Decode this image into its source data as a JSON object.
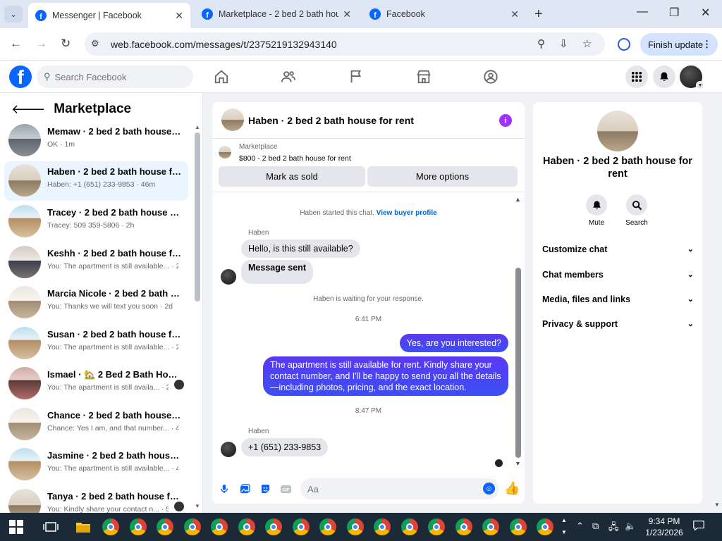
{
  "browser": {
    "tabs": [
      {
        "title": "Messenger | Facebook",
        "active": true
      },
      {
        "title": "Marketplace - 2 bed 2 bath hou",
        "active": false
      },
      {
        "title": "Facebook",
        "active": false
      }
    ],
    "url": "web.facebook.com/messages/t/2375219132943140",
    "update_button": "Finish update"
  },
  "fb_header": {
    "search_placeholder": "Search Facebook"
  },
  "sidebar": {
    "title": "Marketplace",
    "conversations": [
      {
        "name": "Memaw · 2 bed 2 bath house fo...",
        "preview": "OK · 1m",
        "thumb": "room-a"
      },
      {
        "name": "Haben · 2 bed 2 bath house for ...",
        "preview": "Haben: +1 (651) 233-9853 · 46m",
        "thumb": "room-b"
      },
      {
        "name": "Tracey · 2 bed 2 bath house for ...",
        "preview": "Tracey: 509 359-5806 · 2h",
        "thumb": "room-c"
      },
      {
        "name": "Keshh · 2 bed 2 bath house for r...",
        "preview": "You: The apartment is still available... · 2h",
        "thumb": "room-d"
      },
      {
        "name": "Marcia Nicole · 2 bed 2 bath ho...",
        "preview": "You: Thanks we will text you soon · 2d",
        "thumb": "room-e"
      },
      {
        "name": "Susan · 2 bed 2 bath house for r...",
        "preview": "You: The apartment is still available... · 2d",
        "thumb": "room-c"
      },
      {
        "name": "Ismael · 🏡 2 Bed 2 Bath Hou...",
        "preview": "You: The apartment is still availa... · 2d",
        "thumb": "room-f"
      },
      {
        "name": "Chance · 2 bed 2 bath house for...",
        "preview": "Chance: Yes I am, and that number... · 4d",
        "thumb": "room-e"
      },
      {
        "name": "Jasmine · 2 bed 2 bath house fo...",
        "preview": "You: The apartment is still available... · 4d",
        "thumb": "room-c"
      },
      {
        "name": "Tanya · 2 bed 2 bath house fo...",
        "preview": "You: Kindly share your contact n... · 5d",
        "thumb": "room-b"
      }
    ]
  },
  "chat": {
    "title": "Haben · 2 bed 2 bath house for rent",
    "marketplace_label": "Marketplace",
    "listing": "$800 - 2 bed 2 bath house for rent",
    "mark_sold": "Mark as sold",
    "more_options": "More options",
    "started_text": "Haben started this chat.",
    "view_profile": "View buyer profile",
    "sender_name": "Haben",
    "msg_in_1": "Hello, is this still available?",
    "msg_in_2": "Message sent",
    "waiting_text": "Haben is waiting for your response.",
    "time_1": "6:41 PM",
    "msg_out_1": "Yes, are you interested?",
    "msg_out_2": "The apartment is still available for rent. Kindly share your contact number, and I'll be happy to send you all the details—including photos, pricing, and the exact location.",
    "time_2": "8:47 PM",
    "sender_name_2": "Haben",
    "msg_in_3": "+1 (651) 233-9853",
    "composer_placeholder": "Aa"
  },
  "right_panel": {
    "title": "Haben · 2 bed 2 bath house for rent",
    "mute": "Mute",
    "search": "Search",
    "sections": [
      "Customize chat",
      "Chat members",
      "Media, files and links",
      "Privacy & support"
    ]
  },
  "taskbar": {
    "time": "9:34 PM",
    "date": "1/23/2026"
  }
}
